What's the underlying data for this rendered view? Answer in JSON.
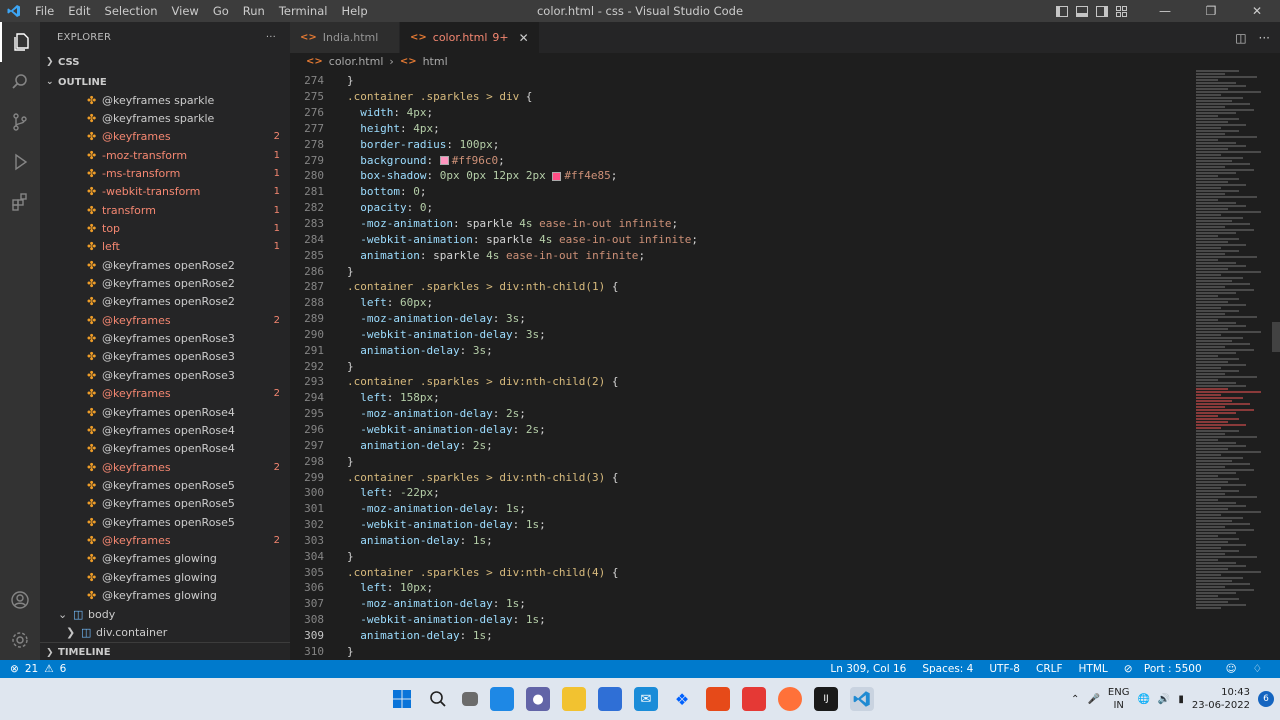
{
  "titlebar": {
    "menu": [
      "File",
      "Edit",
      "Selection",
      "View",
      "Go",
      "Run",
      "Terminal",
      "Help"
    ],
    "window_title": "color.html - css - Visual Studio Code"
  },
  "sidebar": {
    "explorer_label": "EXPLORER",
    "folder": "CSS",
    "outline_label": "OUTLINE",
    "timeline_label": "TIMELINE",
    "outline_items": [
      {
        "label": "@keyframes sparkle",
        "count": ""
      },
      {
        "label": "@keyframes sparkle",
        "count": ""
      },
      {
        "label": "@keyframes",
        "count": "2"
      },
      {
        "label": "-moz-transform",
        "count": "1"
      },
      {
        "label": "-ms-transform",
        "count": "1"
      },
      {
        "label": "-webkit-transform",
        "count": "1"
      },
      {
        "label": "transform",
        "count": "1"
      },
      {
        "label": "top",
        "count": "1"
      },
      {
        "label": "left",
        "count": "1"
      },
      {
        "label": "@keyframes openRose2",
        "count": ""
      },
      {
        "label": "@keyframes openRose2",
        "count": ""
      },
      {
        "label": "@keyframes openRose2",
        "count": ""
      },
      {
        "label": "@keyframes",
        "count": "2"
      },
      {
        "label": "@keyframes openRose3",
        "count": ""
      },
      {
        "label": "@keyframes openRose3",
        "count": ""
      },
      {
        "label": "@keyframes openRose3",
        "count": ""
      },
      {
        "label": "@keyframes",
        "count": "2"
      },
      {
        "label": "@keyframes openRose4",
        "count": ""
      },
      {
        "label": "@keyframes openRose4",
        "count": ""
      },
      {
        "label": "@keyframes openRose4",
        "count": ""
      },
      {
        "label": "@keyframes",
        "count": "2"
      },
      {
        "label": "@keyframes openRose5",
        "count": ""
      },
      {
        "label": "@keyframes openRose5",
        "count": ""
      },
      {
        "label": "@keyframes openRose5",
        "count": ""
      },
      {
        "label": "@keyframes",
        "count": "2"
      },
      {
        "label": "@keyframes glowing",
        "count": ""
      },
      {
        "label": "@keyframes glowing",
        "count": ""
      },
      {
        "label": "@keyframes glowing",
        "count": ""
      }
    ],
    "body_node": "body",
    "container_node": "div.container"
  },
  "editor": {
    "tabs": [
      {
        "label": "India.html",
        "active": false
      },
      {
        "label": "color.html",
        "badge": "9+",
        "active": true
      }
    ],
    "breadcrumb": [
      "color.html",
      "html"
    ],
    "first_line": 274,
    "current_line": 309,
    "lines": [
      "}",
      ".container .sparkles > div {",
      "  width: 4px;",
      "  height: 4px;",
      "  border-radius: 100px;",
      "  background: #ff96c0;",
      "  box-shadow: 0px 0px 12px 2px #ff4e85;",
      "  bottom: 0;",
      "  opacity: 0;",
      "  -moz-animation: sparkle 4s ease-in-out infinite;",
      "  -webkit-animation: sparkle 4s ease-in-out infinite;",
      "  animation: sparkle 4s ease-in-out infinite;",
      "}",
      ".container .sparkles > div:nth-child(1) {",
      "  left: 60px;",
      "  -moz-animation-delay: 3s;",
      "  -webkit-animation-delay: 3s;",
      "  animation-delay: 3s;",
      "}",
      ".container .sparkles > div:nth-child(2) {",
      "  left: 158px;",
      "  -moz-animation-delay: 2s;",
      "  -webkit-animation-delay: 2s;",
      "  animation-delay: 2s;",
      "}",
      ".container .sparkles > div:nth-child(3) {",
      "  left: -22px;",
      "  -moz-animation-delay: 1s;",
      "  -webkit-animation-delay: 1s;",
      "  animation-delay: 1s;",
      "}",
      ".container .sparkles > div:nth-child(4) {",
      "  left: 10px;",
      "  -moz-animation-delay: 1s;",
      "  -webkit-animation-delay: 1s;",
      "  animation-delay: 1s;",
      "}"
    ],
    "swatch_colors": {
      "ff96c0": "#ff96c0",
      "ff4e85": "#ff4e85"
    }
  },
  "statusbar": {
    "errors": "21",
    "warnings": "6",
    "position": "Ln 309, Col 16",
    "spaces": "Spaces: 4",
    "encoding": "UTF-8",
    "eol": "CRLF",
    "language": "HTML",
    "port": "Port : 5500"
  },
  "taskbar": {
    "lang1": "ENG",
    "lang2": "IN",
    "time": "10:43",
    "date": "23-06-2022",
    "notifications": "6"
  },
  "colors": {
    "accent": "#007acc",
    "error_text": "#f48771",
    "symbol": "#ee9d28"
  }
}
